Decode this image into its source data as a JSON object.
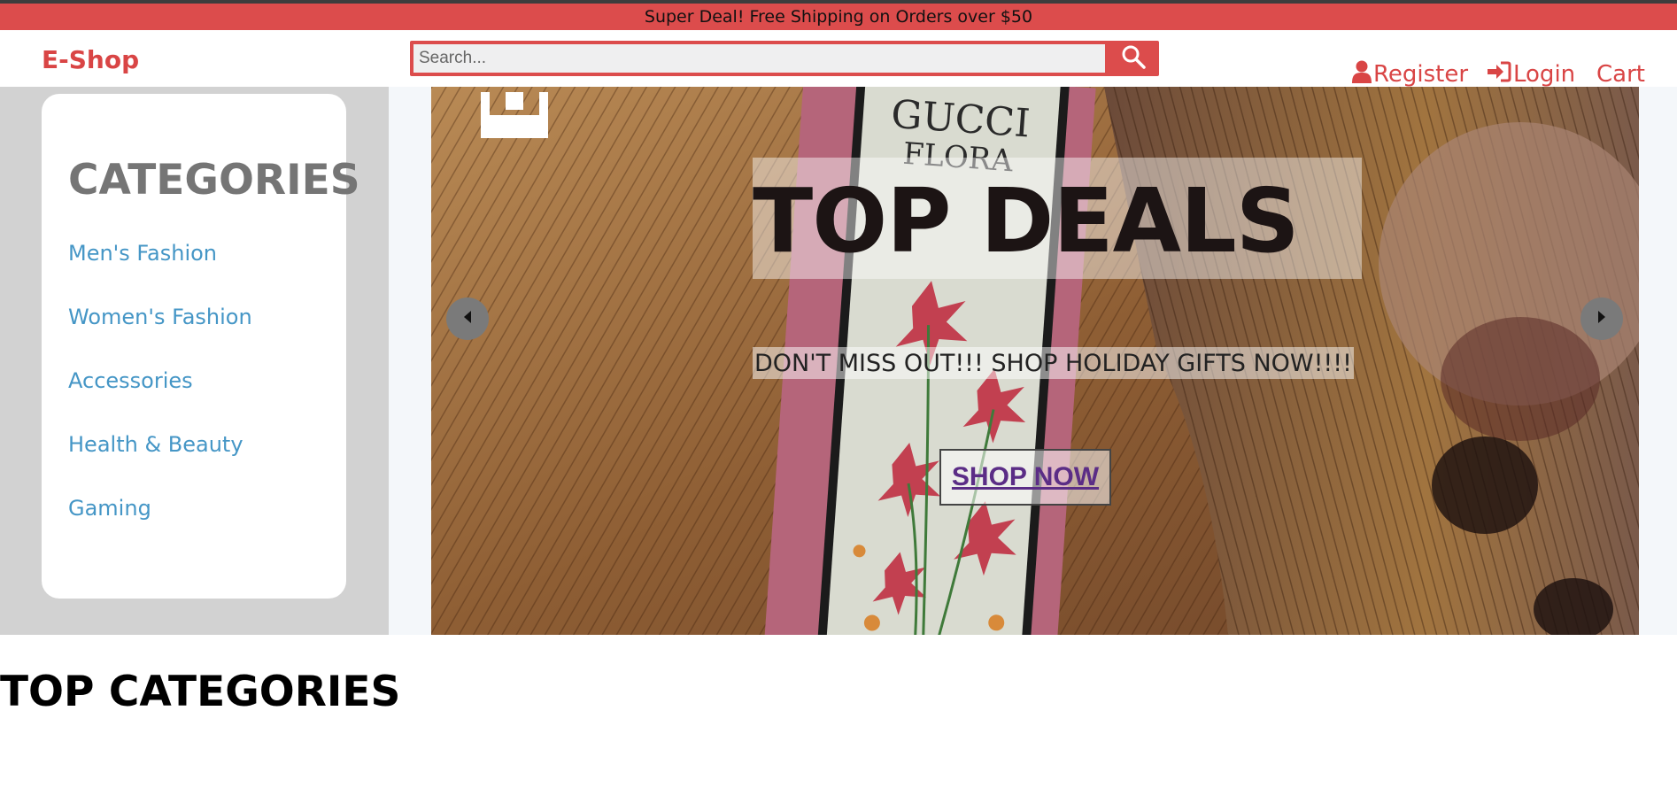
{
  "promo": {
    "text": "Super Deal! Free Shipping on Orders over $50"
  },
  "header": {
    "logo": "E-Shop",
    "search": {
      "placeholder": "Search...",
      "value": ""
    },
    "nav": {
      "register": "Register",
      "login": "Login",
      "cart": "Cart"
    }
  },
  "sidebar": {
    "title": "CATEGORIES",
    "items": [
      {
        "label": "Men's Fashion"
      },
      {
        "label": "Women's Fashion"
      },
      {
        "label": "Accessories"
      },
      {
        "label": "Health & Beauty"
      },
      {
        "label": "Gaming"
      }
    ]
  },
  "hero": {
    "title": "TOP DEALS",
    "subtitle": "DON'T MISS OUT!!! SHOP HOLIDAY GIFTS NOW!!!!",
    "cta": "SHOP NOW",
    "prev_icon": "caret-left-icon",
    "next_icon": "caret-right-icon"
  },
  "section": {
    "title": "TOP CATEGORIES"
  },
  "colors": {
    "accent": "#dc4c4c",
    "link": "#4596c6",
    "sidebar_bg": "#d2d2d2",
    "cta_text": "#5b2d86"
  }
}
